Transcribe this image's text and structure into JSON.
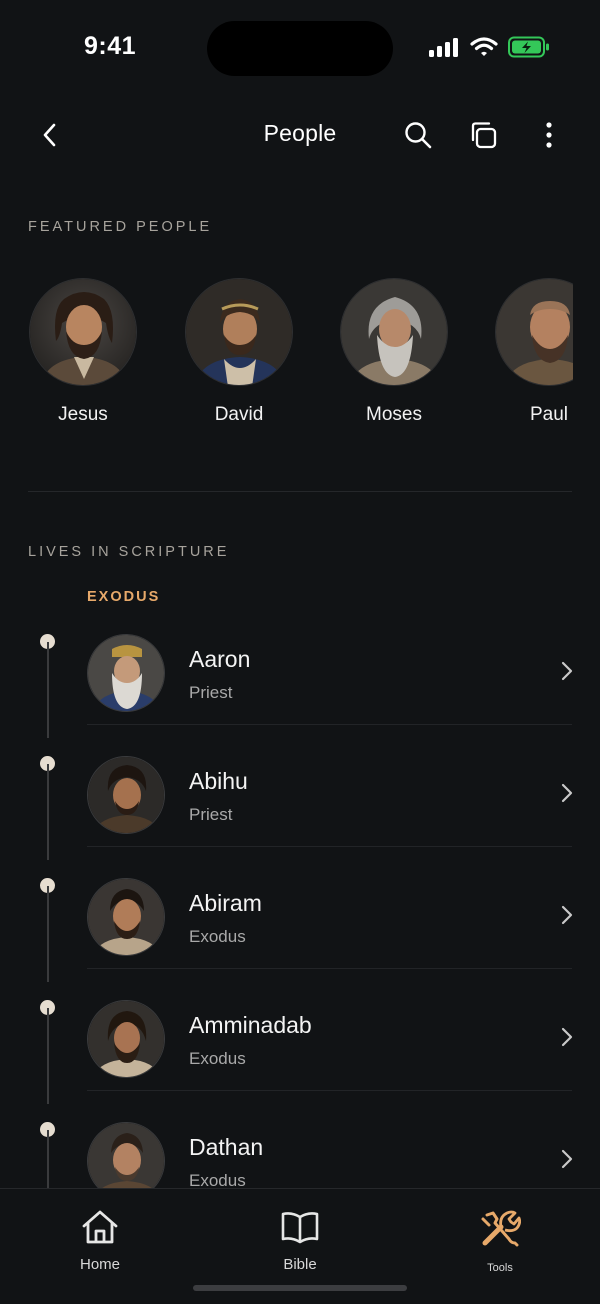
{
  "status_bar": {
    "time": "9:41"
  },
  "header": {
    "title": "People"
  },
  "featured": {
    "heading": "FEATURED PEOPLE",
    "people": [
      {
        "name": "Jesus"
      },
      {
        "name": "David"
      },
      {
        "name": "Moses"
      },
      {
        "name": "Paul"
      }
    ]
  },
  "scripture": {
    "heading": "LIVES IN SCRIPTURE",
    "book": "EXODUS",
    "people": [
      {
        "name": "Aaron",
        "role": "Priest"
      },
      {
        "name": "Abihu",
        "role": "Priest"
      },
      {
        "name": "Abiram",
        "role": "Exodus"
      },
      {
        "name": "Amminadab",
        "role": "Exodus"
      },
      {
        "name": "Dathan",
        "role": "Exodus"
      }
    ]
  },
  "tab_bar": {
    "tabs": [
      {
        "label": "Home",
        "icon": "home-icon"
      },
      {
        "label": "Bible",
        "icon": "book-icon"
      },
      {
        "label": "Tools",
        "icon": "tools-icon",
        "active": true
      }
    ],
    "active_color": "#e7a96a"
  },
  "colors": {
    "background": "#111315",
    "accent": "#e7a96a",
    "battery": "#34c759"
  }
}
